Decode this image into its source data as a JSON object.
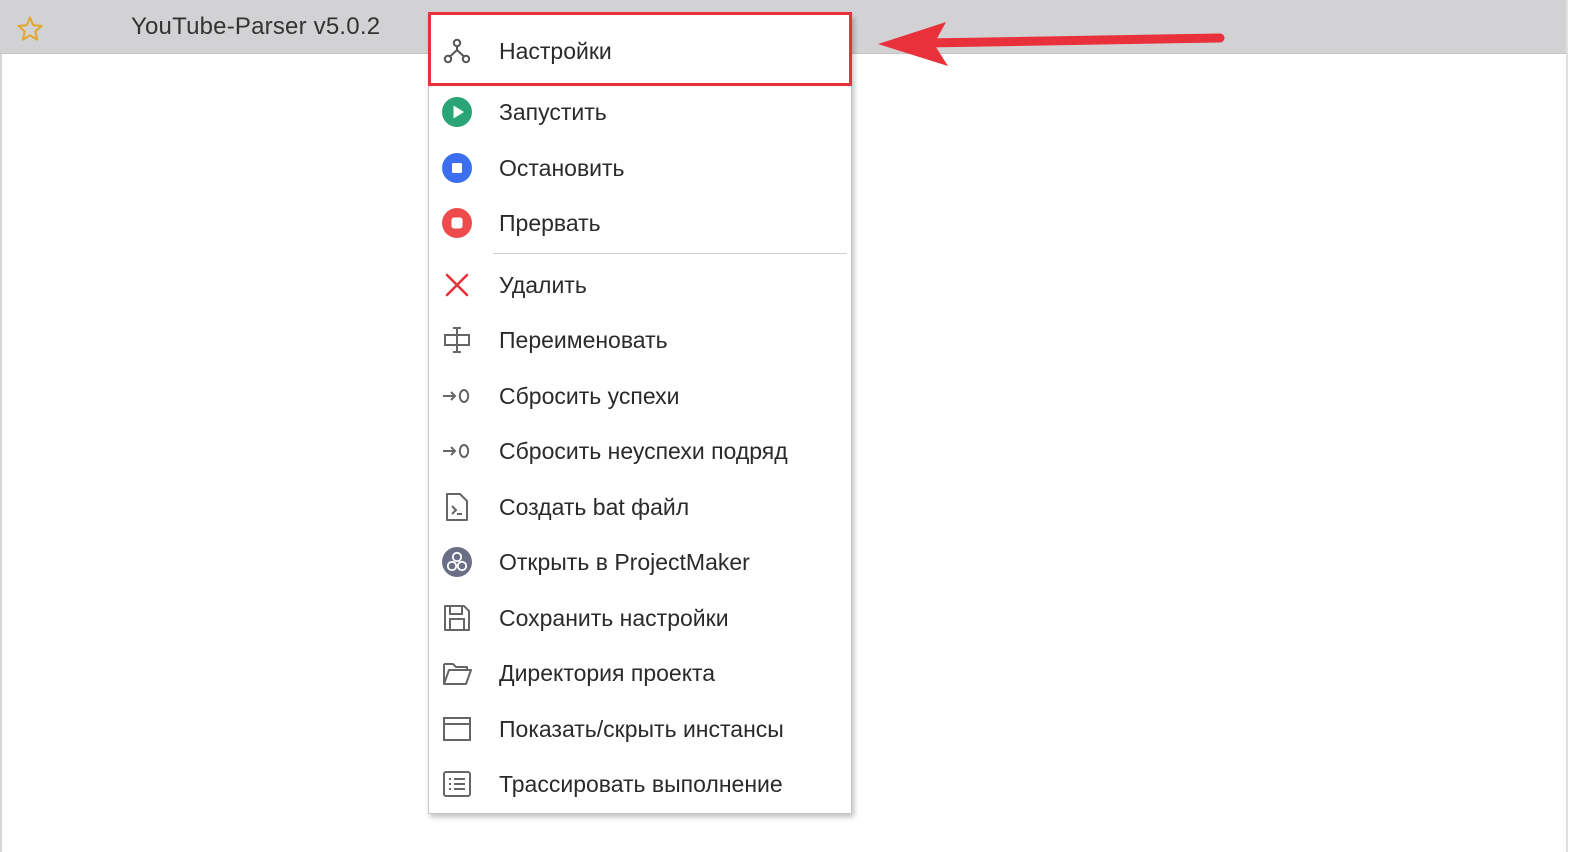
{
  "project": {
    "title": "YouTube-Parser v5.0.2"
  },
  "icons": {
    "favorite": "star-outline-icon"
  },
  "colors": {
    "highlight": "#e8313a",
    "start": "#2aa577",
    "stop": "#3b6ff0",
    "abort": "#ee4c4c",
    "delete": "#e8313a",
    "row_bar": "#d2d2d4"
  },
  "context_menu": {
    "items": [
      {
        "label": "Настройки",
        "icon": "settings-hierarchy-icon"
      },
      {
        "label": "Запустить",
        "icon": "play-circle-icon"
      },
      {
        "label": "Остановить",
        "icon": "stop-circle-icon"
      },
      {
        "label": "Прервать",
        "icon": "abort-circle-icon"
      },
      {
        "label": "Удалить",
        "icon": "delete-x-icon"
      },
      {
        "label": "Переименовать",
        "icon": "rename-cursor-icon"
      },
      {
        "label": "Сбросить успехи",
        "icon": "reset-to-zero-icon"
      },
      {
        "label": "Сбросить неуспехи подряд",
        "icon": "reset-to-zero-icon"
      },
      {
        "label": "Создать bat файл",
        "icon": "script-file-icon"
      },
      {
        "label": "Открыть в ProjectMaker",
        "icon": "projectmaker-icon"
      },
      {
        "label": "Сохранить настройки",
        "icon": "save-floppy-icon"
      },
      {
        "label": "Директория проекта",
        "icon": "folder-open-icon"
      },
      {
        "label": "Показать/скрыть инстансы",
        "icon": "window-icon"
      },
      {
        "label": "Трассировать выполнение",
        "icon": "list-trace-icon"
      }
    ]
  }
}
